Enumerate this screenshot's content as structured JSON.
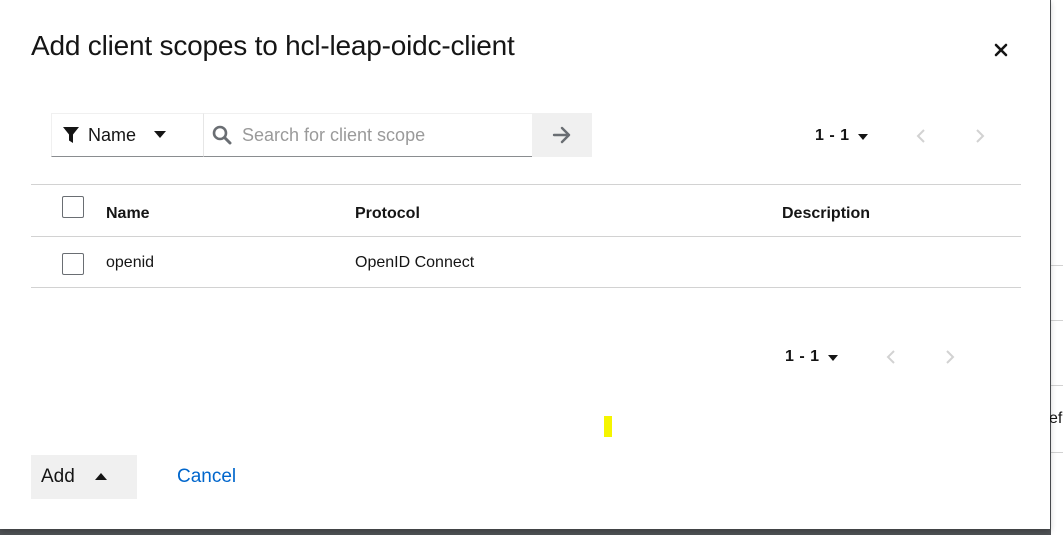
{
  "dialog": {
    "title": "Add client scopes to hcl-leap-oidc-client",
    "close_icon": "close-icon"
  },
  "toolbar": {
    "filter_icon": "filter-icon",
    "filter_label": "Name",
    "search_placeholder": "Search for client scope",
    "search_value": "",
    "search_button_icon": "arrow-right-icon"
  },
  "pagination_top": {
    "range": "1 - 1"
  },
  "pagination_bottom": {
    "range": "1 - 1"
  },
  "table": {
    "columns": [
      "Name",
      "Protocol",
      "Description"
    ],
    "rows": [
      {
        "name": "openid",
        "protocol": "OpenID Connect",
        "description": ""
      }
    ]
  },
  "footer": {
    "add_label": "Add",
    "cancel_label": "Cancel"
  },
  "background": {
    "partial_text": "ef"
  },
  "colors": {
    "link": "#0066cc",
    "button_bg": "#f0f0f0",
    "cursor_highlight": "#f5f500"
  }
}
